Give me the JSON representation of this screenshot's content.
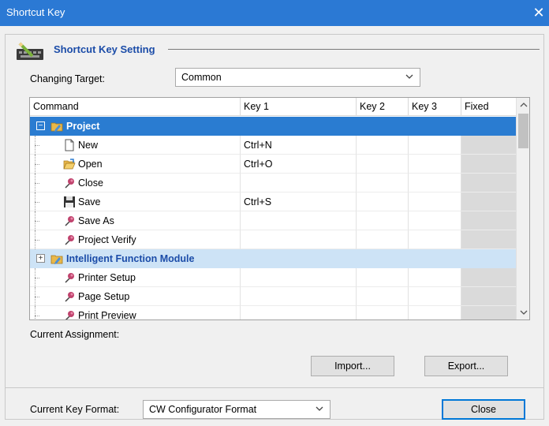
{
  "window": {
    "title": "Shortcut Key",
    "close_glyph": "✕"
  },
  "section": {
    "title": "Shortcut Key Setting",
    "icon": "keyboard-pencil-icon"
  },
  "changing_target": {
    "label": "Changing Target:",
    "value": "Common"
  },
  "table": {
    "columns": [
      "Command",
      "Key 1",
      "Key 2",
      "Key 3",
      "Fixed"
    ],
    "rows": [
      {
        "type": "group",
        "expander": "−",
        "icon": "folder-icon",
        "label": "Project",
        "state": "selected",
        "keys": [
          "",
          "",
          ""
        ]
      },
      {
        "type": "item",
        "icon": "document-icon",
        "label": "New",
        "keys": [
          "Ctrl+N",
          "",
          ""
        ]
      },
      {
        "type": "item",
        "icon": "open-folder-icon",
        "label": "Open",
        "keys": [
          "Ctrl+O",
          "",
          ""
        ]
      },
      {
        "type": "item",
        "icon": "pin-icon",
        "label": "Close",
        "keys": [
          "",
          "",
          ""
        ]
      },
      {
        "type": "item",
        "icon": "save-disk-icon",
        "label": "Save",
        "keys": [
          "Ctrl+S",
          "",
          ""
        ]
      },
      {
        "type": "item",
        "icon": "pin-icon",
        "label": "Save As",
        "keys": [
          "",
          "",
          ""
        ]
      },
      {
        "type": "item",
        "icon": "pin-icon",
        "label": "Project Verify",
        "keys": [
          "",
          "",
          ""
        ]
      },
      {
        "type": "group",
        "expander": "+",
        "icon": "folder-icon",
        "label": "Intelligent Function Module",
        "state": "highlight",
        "keys": [
          "",
          "",
          ""
        ]
      },
      {
        "type": "item",
        "icon": "pin-icon",
        "label": "Printer Setup",
        "keys": [
          "",
          "",
          ""
        ]
      },
      {
        "type": "item",
        "icon": "pin-icon",
        "label": "Page Setup",
        "keys": [
          "",
          "",
          ""
        ]
      },
      {
        "type": "item",
        "icon": "pin-icon",
        "label": "Print Preview",
        "keys": [
          "",
          "",
          ""
        ]
      }
    ]
  },
  "current_assignment": {
    "label": "Current Assignment:"
  },
  "buttons": {
    "import": "Import...",
    "export": "Export...",
    "close": "Close"
  },
  "key_format": {
    "label": "Current Key Format:",
    "value": "CW Configurator Format"
  },
  "colors": {
    "titlebar": "#2b79d4",
    "selected_row": "#2a7cd1",
    "highlight_row": "#cde3f6",
    "section_title": "#1b4ca8"
  }
}
